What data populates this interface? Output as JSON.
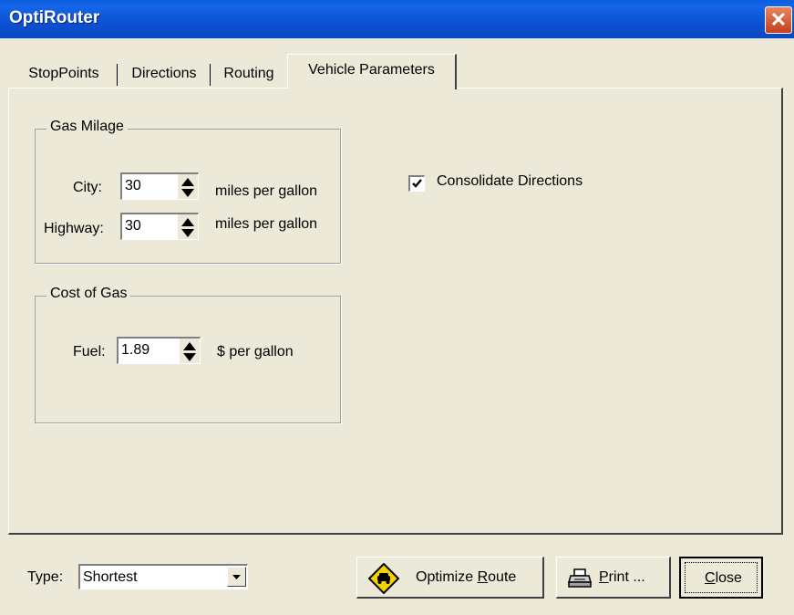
{
  "window": {
    "title": "OptiRouter",
    "close_glyph": "✕"
  },
  "tabs": [
    {
      "label": "StopPoints"
    },
    {
      "label": "Directions"
    },
    {
      "label": "Routing"
    },
    {
      "label": "Vehicle Parameters",
      "active": true
    }
  ],
  "gas_milage": {
    "title": "Gas Milage",
    "city": {
      "label": "City:",
      "value": "30",
      "unit": "miles per gallon"
    },
    "highway": {
      "label": "Highway:",
      "value": "30",
      "unit": "miles per gallon"
    }
  },
  "cost_of_gas": {
    "title": "Cost of Gas",
    "fuel": {
      "label": "Fuel:",
      "value": "1.89",
      "unit": "$ per gallon"
    }
  },
  "consolidate": {
    "label": "Consolidate Directions",
    "checked": true
  },
  "footer": {
    "type_label": "Type:",
    "type_value": "Shortest",
    "optimize_prefix": "Optimize ",
    "optimize_mnemonic": "R",
    "optimize_suffix": "oute",
    "print_mnemonic": "P",
    "print_suffix": "rint ...",
    "close_mnemonic": "C",
    "close_suffix": "lose"
  },
  "icons": {
    "optimize": "car-warning-sign-icon",
    "print": "printer-icon",
    "close": "close-icon"
  },
  "colors": {
    "titlebar": "#0a5fe0",
    "window_bg": "#ece9d8",
    "close_button": "#c4401d",
    "sign_yellow": "#f5d300"
  }
}
